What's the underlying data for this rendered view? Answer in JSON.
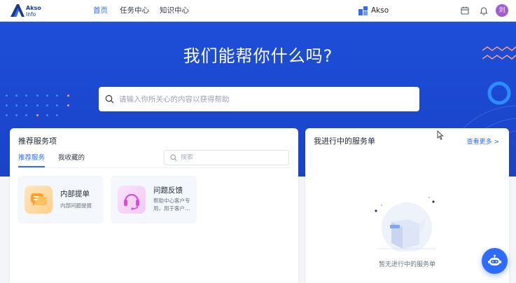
{
  "header": {
    "logo_line1": "Akso",
    "logo_line2": "Info",
    "nav": [
      {
        "label": "首页",
        "active": true
      },
      {
        "label": "任务中心",
        "active": false
      },
      {
        "label": "知识中心",
        "active": false
      }
    ],
    "tenant_name": "Akso",
    "avatar_text": "刘",
    "icons": [
      "calendar-icon",
      "bell-icon"
    ]
  },
  "hero": {
    "title": "我们能帮你什么吗?",
    "search_placeholder": "请输入你所关心的内容以获得帮助"
  },
  "recommend": {
    "title": "推荐服务项",
    "tabs": [
      {
        "label": "推荐服务",
        "active": true
      },
      {
        "label": "我收藏的",
        "active": false
      }
    ],
    "search_placeholder": "搜索",
    "services": [
      {
        "title": "内部提单",
        "desc": "内部问题提报",
        "icon": "chat-bubble-icon"
      },
      {
        "title": "问题反馈",
        "desc": "帮助中心客户专用，用于客户...",
        "icon": "headset-icon"
      }
    ]
  },
  "my_tickets": {
    "title": "我进行中的服务单",
    "more_label": "查看更多 >",
    "empty_text": "暂无进行中的服务单"
  },
  "colors": {
    "primary": "#2f6bff",
    "hero_bg": "#1e4fd8",
    "avatar_bg": "#a05bd6"
  }
}
